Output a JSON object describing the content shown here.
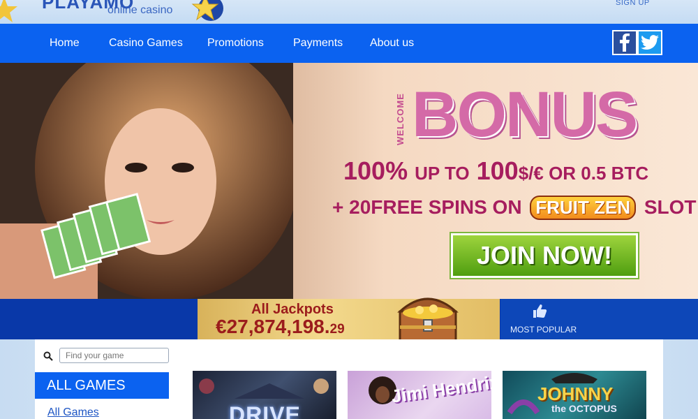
{
  "header": {
    "logo_title": "PLAYAMO",
    "logo_subtitle": "online casino",
    "signup_label": "SIGN UP"
  },
  "nav": {
    "items": [
      {
        "label": "Home"
      },
      {
        "label": "Casino Games"
      },
      {
        "label": "Promotions"
      },
      {
        "label": "Payments"
      },
      {
        "label": "About us"
      }
    ],
    "social": [
      "facebook-icon",
      "twitter-icon"
    ]
  },
  "hero": {
    "welcome": "WELCOME",
    "bonus": "BONUS",
    "offer_percent": "100%",
    "offer_upto": "UP TO",
    "offer_amount": "100",
    "offer_rest": "$/€ OR 0.5 BTC",
    "spins_prefix": "+ 20FREE SPINS ON",
    "spins_game": "FRUIT ZEN",
    "spins_suffix": "SLOT",
    "join_label": "JOIN NOW!"
  },
  "jackpot": {
    "label": "All Jackpots",
    "value_main": "€27,874,198.",
    "value_cents": "29"
  },
  "popular": {
    "label": "MOST POPULAR"
  },
  "sidebar": {
    "search_placeholder": "Find your game",
    "all_games_heading": "ALL GAMES",
    "all_games_link": "All Games"
  },
  "games": [
    {
      "title": "DRIVE"
    },
    {
      "title": "Jimi Hendrix"
    },
    {
      "title": "JOHNNY",
      "subtitle": "the OCTOPUS"
    }
  ],
  "colors": {
    "nav_blue": "#0b62f0",
    "jackpot_red": "#9b1c1c",
    "bonus_pink": "#d46aa7",
    "join_green": "#4f9e10"
  }
}
